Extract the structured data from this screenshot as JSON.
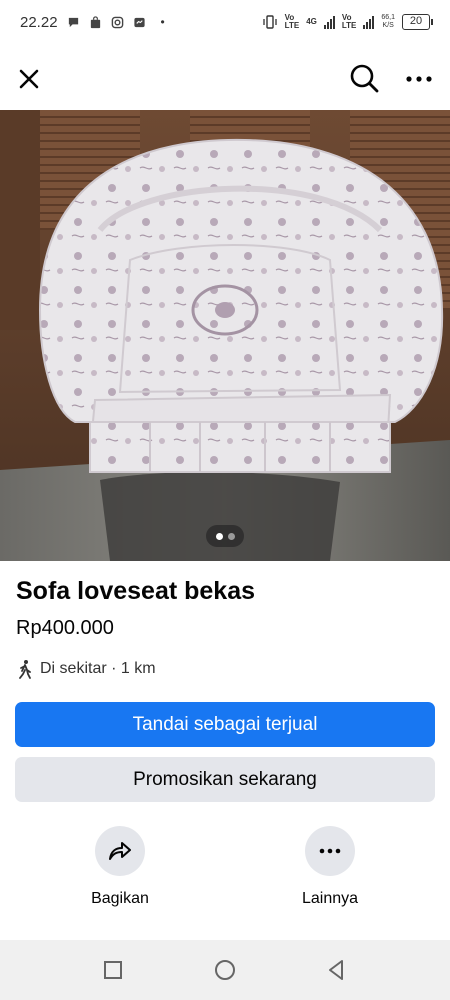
{
  "status_bar": {
    "time": "22.22",
    "notification_icons": [
      "chat-bubble-icon",
      "shopping-bag-icon",
      "instagram-icon",
      "messenger-icon"
    ],
    "dot": "•",
    "network1_top": "Vo",
    "network1_bottom": "LTE",
    "network2": "4G",
    "network3_top": "Vo",
    "network3_bottom": "LTE",
    "speed_value": "66,1",
    "speed_unit": "K/S",
    "battery": "20"
  },
  "listing": {
    "title": "Sofa loveseat bekas",
    "price": "Rp400.000",
    "location": "Di sekitar · 1 km",
    "photo_count": 2,
    "active_photo": 1
  },
  "buttons": {
    "mark_sold": "Tandai sebagai terjual",
    "promote": "Promosikan sekarang"
  },
  "actions": {
    "share": "Bagikan",
    "more": "Lainnya"
  },
  "colors": {
    "primary": "#1877f2",
    "secondary_bg": "#e4e6eb"
  }
}
